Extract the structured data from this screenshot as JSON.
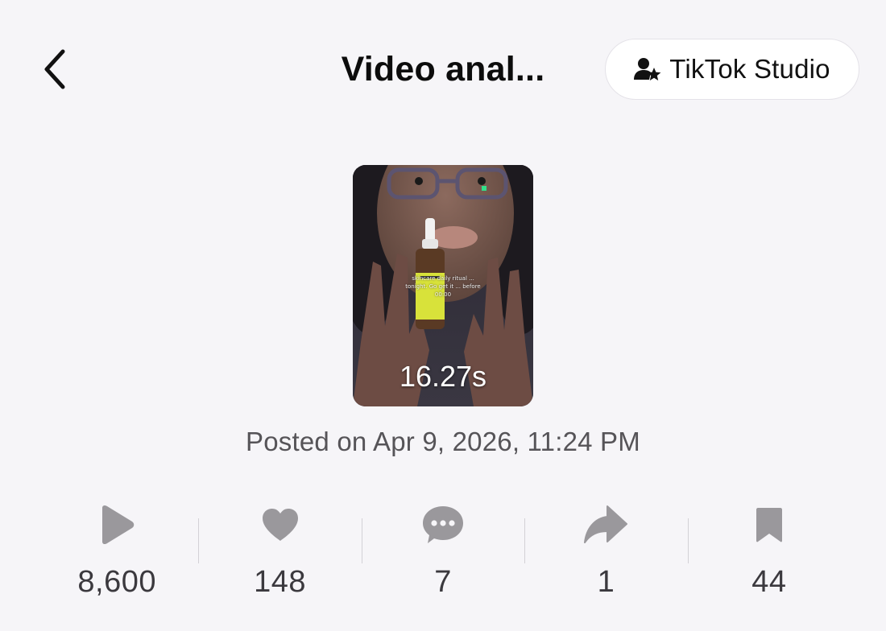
{
  "header": {
    "title": "Video anal...",
    "studio_button_label": "TikTok Studio"
  },
  "video": {
    "duration": "16.27s",
    "caption": "skincare daily ritual ... tonight. Go get it ... before 00:00",
    "posted": "Posted on Apr 9, 2026, 11:24 PM"
  },
  "stats": [
    {
      "icon": "play-icon",
      "value": "8,600"
    },
    {
      "icon": "heart-icon",
      "value": "148"
    },
    {
      "icon": "comment-icon",
      "value": "7"
    },
    {
      "icon": "share-icon",
      "value": "1"
    },
    {
      "icon": "bookmark-icon",
      "value": "44"
    }
  ],
  "colors": {
    "background": "#f6f5f8",
    "icon_gray": "#9a989c",
    "value_text": "#3b393e",
    "secondary_text": "#565458"
  }
}
